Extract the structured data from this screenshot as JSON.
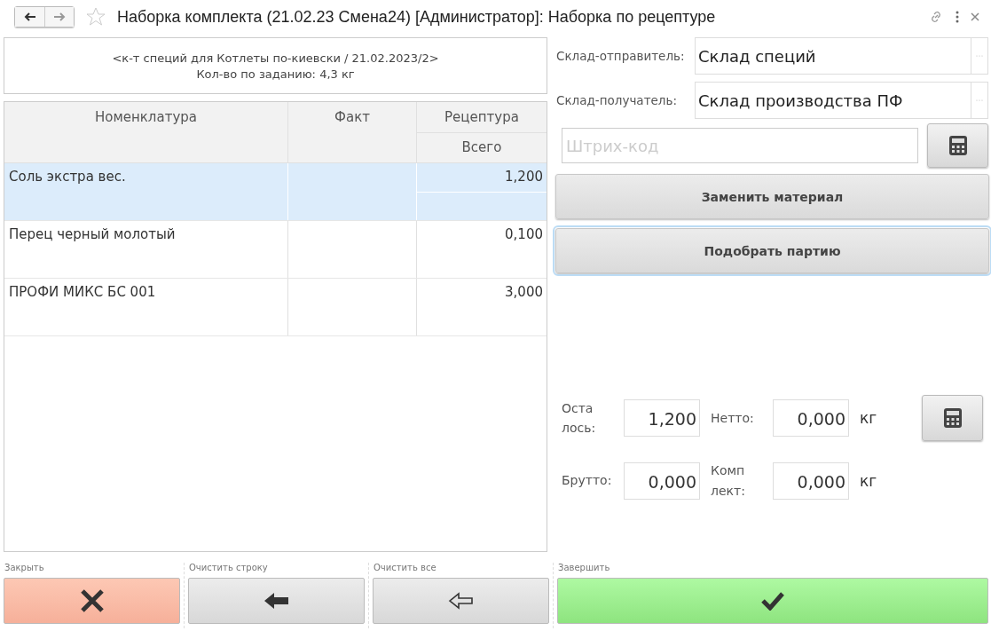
{
  "window": {
    "title": "Наборка комплекта (21.02.23 Смена24) [Администратор]: Наборка по рецептуре"
  },
  "task": {
    "lines": [
      "<к-т специй для Котлеты по-киевски / 21.02.2023/2>",
      "Кол-во по заданию: 4,3 кг"
    ]
  },
  "table": {
    "columns": [
      "Номенклатура",
      "Факт",
      "Рецептура"
    ],
    "subcolumn": "Всего",
    "rows": [
      {
        "name": "Соль экстра вес.",
        "fact": "",
        "total": "1,200",
        "selected": true
      },
      {
        "name": "Перец черный молотый",
        "fact": "",
        "total": "0,100",
        "selected": false
      },
      {
        "name": "ПРОФИ МИКС БС 001",
        "fact": "",
        "total": "3,000",
        "selected": false
      }
    ]
  },
  "warehouses": [
    {
      "label": "Склад-отправитель:",
      "value": "Склад специй"
    },
    {
      "label": "Склад-получатель:",
      "value": "Склад производства ПФ"
    }
  ],
  "barcode": {
    "placeholder": "Штрих-код"
  },
  "actions": [
    {
      "label": "Заменить материал",
      "selected": false
    },
    {
      "label": "Подобрать партию",
      "selected": true
    }
  ],
  "weights": [
    {
      "kind": "wrapped",
      "label": "Осталось:",
      "value": "1,200"
    },
    {
      "kind": "plain",
      "label": "Нетто:",
      "value": "0,000",
      "unit": "кг"
    },
    {
      "kind": "plain",
      "label": "Брутто:",
      "value": "0,000"
    },
    {
      "kind": "wrapped",
      "label": "Комплект:",
      "value": "0,000",
      "unit": "кг"
    }
  ],
  "footer": [
    {
      "kind": "close",
      "caption": "Закрыть"
    },
    {
      "kind": "clear-row",
      "caption": "Очистить строку"
    },
    {
      "kind": "clear-all",
      "caption": "Очистить все"
    },
    {
      "kind": "finish",
      "caption": "Завершить"
    }
  ]
}
